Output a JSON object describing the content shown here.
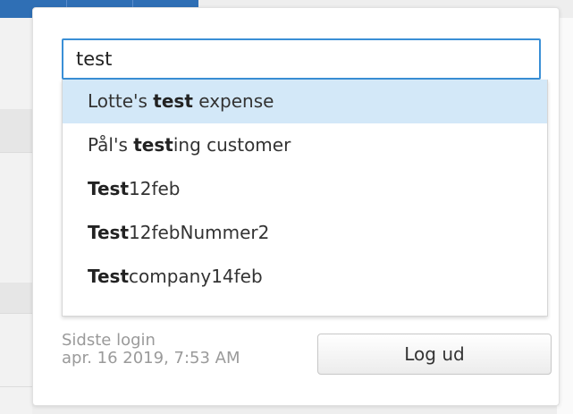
{
  "search": {
    "value": "test"
  },
  "suggestions": [
    {
      "before": "Lotte's ",
      "match": "test",
      "after": " expense",
      "active": true
    },
    {
      "before": "Pål's ",
      "match": "test",
      "after": "ing customer",
      "active": false
    },
    {
      "before": "",
      "match": "Test",
      "after": "12feb",
      "active": false
    },
    {
      "before": "",
      "match": "Test",
      "after": "12febNummer2",
      "active": false
    },
    {
      "before": "",
      "match": "Test",
      "after": "company14feb",
      "active": false
    }
  ],
  "session": {
    "last_login_label": "Sidste login",
    "last_login_value": "apr. 16 2019, 7:53 AM",
    "logout_label": "Log ud"
  },
  "colors": {
    "accent": "#3a8fd6",
    "active_row": "#d3e8f8",
    "topbar": "#2f6fb5"
  }
}
